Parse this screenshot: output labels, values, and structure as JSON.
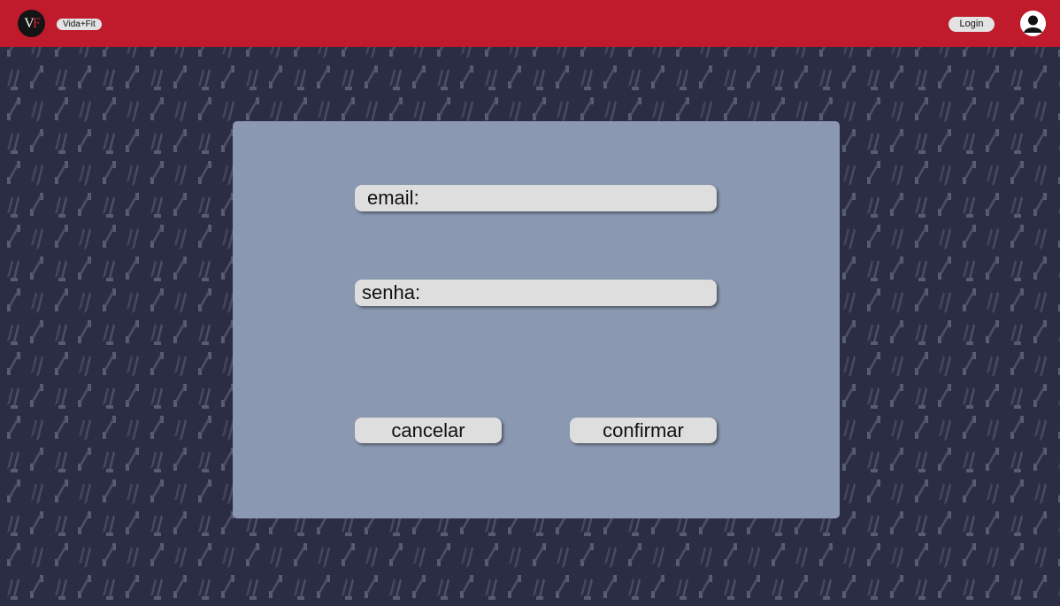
{
  "header": {
    "logo_text": "VF",
    "brand": "Vida+Fit",
    "login_label": "Login",
    "background": "#bf1b2c"
  },
  "form": {
    "email_label": "email:",
    "password_label": "senha:",
    "cancel_label": "cancelar",
    "confirm_label": "confirmar",
    "panel_color": "#8b98b1"
  },
  "icons": {
    "logo": "vidafit-logo-icon",
    "avatar": "user-avatar-icon"
  }
}
